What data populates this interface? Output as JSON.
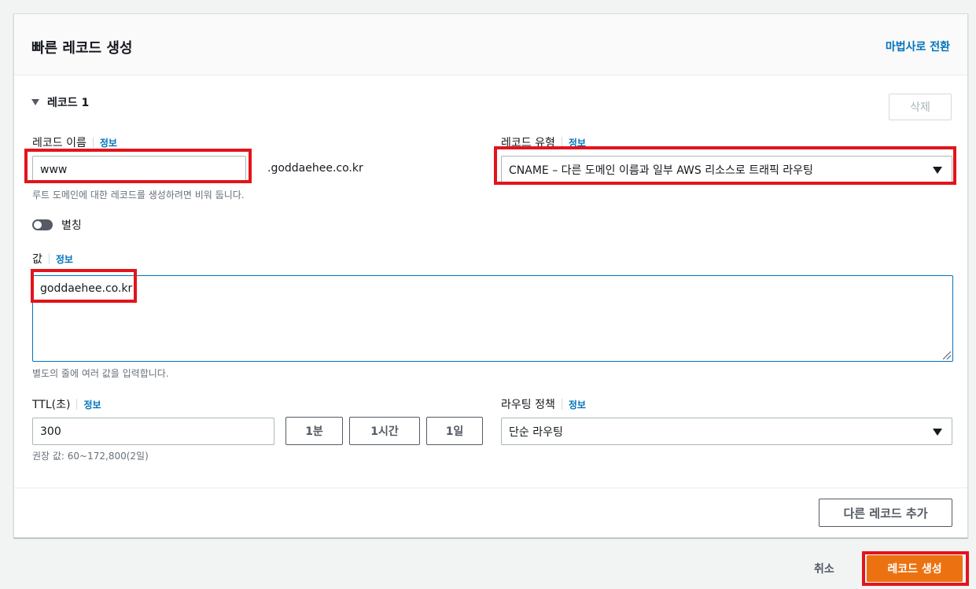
{
  "panel": {
    "title": "빠른 레코드 생성",
    "wizard_link": "마법사로 전환"
  },
  "record": {
    "heading": "레코드 1",
    "delete_label": "삭제",
    "name": {
      "label": "레코드 이름",
      "info": "정보",
      "value": "www",
      "suffix": ".goddaehee.co.kr",
      "hint": "루트 도메인에 대한 레코드를 생성하려면 비워 둡니다."
    },
    "type": {
      "label": "레코드 유형",
      "info": "정보",
      "value": "CNAME – 다른 도메인 이름과 일부 AWS 리소스로 트래픽 라우팅"
    },
    "alias": {
      "label": "별칭",
      "enabled": false
    },
    "value": {
      "label": "값",
      "info": "정보",
      "content": "goddaehee.co.kr",
      "hint": "별도의 줄에 여러 값을 입력합니다."
    },
    "ttl": {
      "label": "TTL(초)",
      "info": "정보",
      "value": "300",
      "presets": [
        "1분",
        "1시간",
        "1일"
      ],
      "hint": "권장 값: 60~172,800(2일)"
    },
    "routing": {
      "label": "라우팅 정책",
      "info": "정보",
      "value": "단순 라우팅"
    }
  },
  "add_record_label": "다른 레코드 추가",
  "footer": {
    "cancel_label": "취소",
    "create_label": "레코드 생성"
  },
  "colors": {
    "accent": "#0073bb",
    "primary": "#ec7211",
    "highlight": "#e2141c"
  }
}
